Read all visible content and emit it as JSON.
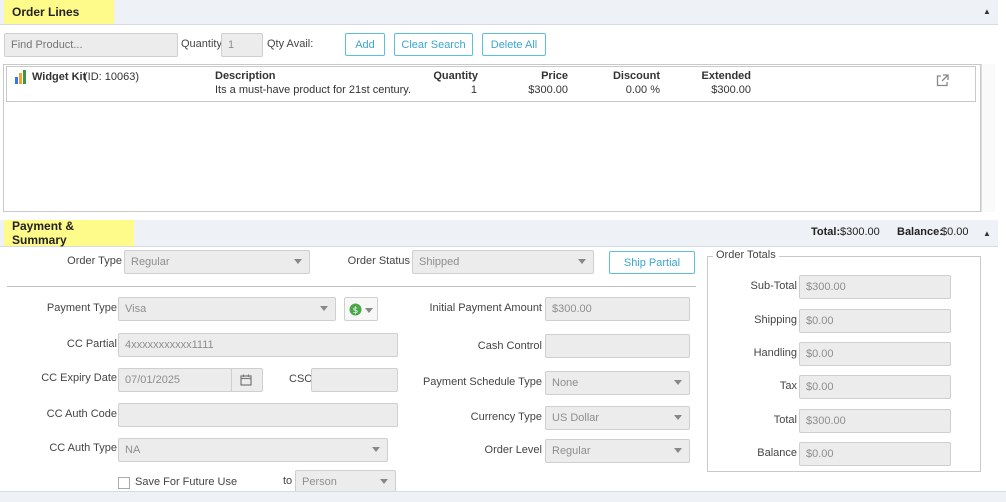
{
  "order_lines": {
    "title": "Order Lines",
    "find_placeholder": "Find Product...",
    "quantity_label": "Quantity",
    "quantity_value": "1",
    "qty_avail_label": "Qty Avail:",
    "add_label": "Add",
    "clear_search_label": "Clear Search",
    "delete_all_label": "Delete All",
    "table": {
      "headers": {
        "description": "Description",
        "quantity": "Quantity",
        "price": "Price",
        "discount": "Discount",
        "extended": "Extended"
      },
      "rows": [
        {
          "product_name": "Widget Kit",
          "product_id": "(ID: 10063)",
          "description": "Its a must-have product for 21st century.",
          "quantity": "1",
          "price": "$300.00",
          "discount": "0.00 %",
          "extended": "$300.00"
        }
      ]
    }
  },
  "payment_summary": {
    "title": "Payment & Summary",
    "total_label": "Total:",
    "total_value": "$300.00",
    "balance_label": "Balance:",
    "balance_value": "$0.00",
    "order_type_label": "Order Type",
    "order_type_value": "Regular",
    "order_status_label": "Order Status",
    "order_status_value": "Shipped",
    "ship_partial_label": "Ship Partial",
    "payment_type_label": "Payment Type",
    "payment_type_value": "Visa",
    "cc_partial_label": "CC Partial",
    "cc_partial_value": "4xxxxxxxxxxx1111",
    "cc_expiry_label": "CC Expiry Date",
    "cc_expiry_value": "07/01/2025",
    "csc_label": "CSC",
    "cc_auth_code_label": "CC Auth Code",
    "cc_auth_type_label": "CC Auth Type",
    "cc_auth_type_value": "NA",
    "save_future_label": "Save For Future Use",
    "to_label": "to",
    "to_value": "Person",
    "initial_payment_label": "Initial Payment Amount",
    "initial_payment_value": "$300.00",
    "cash_control_label": "Cash Control",
    "payment_schedule_label": "Payment Schedule Type",
    "payment_schedule_value": "None",
    "currency_type_label": "Currency Type",
    "currency_type_value": "US Dollar",
    "order_level_label": "Order Level",
    "order_level_value": "Regular"
  },
  "order_totals": {
    "title": "Order Totals",
    "subtotal_label": "Sub-Total",
    "subtotal_value": "$300.00",
    "shipping_label": "Shipping",
    "shipping_value": "$0.00",
    "handling_label": "Handling",
    "handling_value": "$0.00",
    "tax_label": "Tax",
    "tax_value": "$0.00",
    "total_label": "Total",
    "total_value": "$300.00",
    "balance_label": "Balance",
    "balance_value": "$0.00"
  },
  "colors": {
    "accent": "#5bc0de",
    "highlight": "#fffb8a"
  },
  "icons": {
    "product": "bar-chart-icon",
    "external_link": "external-link-icon",
    "calendar": "calendar-icon",
    "currency": "dollar-circle-icon"
  }
}
